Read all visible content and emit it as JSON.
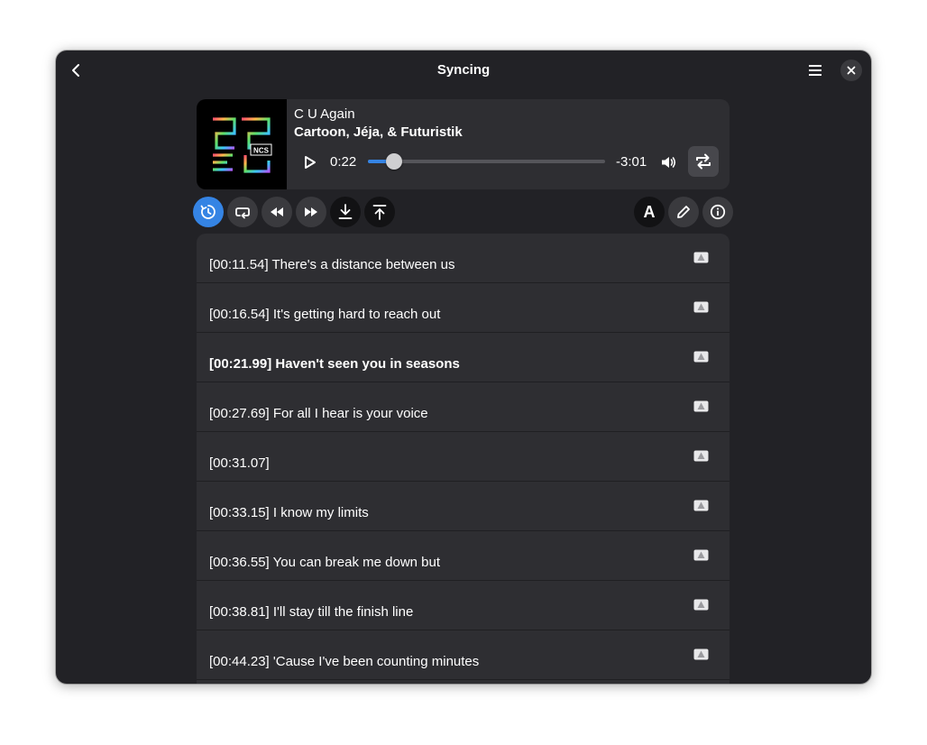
{
  "window": {
    "title": "Syncing"
  },
  "player": {
    "song_title": "C U Again",
    "artist": "Cartoon, Jéja, & Futuristik",
    "time_current": "0:22",
    "time_remaining": "-3:01",
    "progress": 0.11,
    "cover_text": "NCS",
    "accent": "#3584e4"
  },
  "toolbar": {
    "text_style_label": "A",
    "icons": [
      "sync-icon",
      "loop-line-icon",
      "rewind-icon",
      "fast-forward-icon",
      "download-icon",
      "upload-icon",
      "font-icon",
      "edit-icon",
      "info-icon"
    ]
  },
  "lyrics": {
    "current_index": 2,
    "lines": [
      "[00:11.54] There's a distance between us",
      "[00:16.54] It's getting hard to reach out",
      "[00:21.99] Haven't seen you in seasons",
      "[00:27.69] For all I hear is your voice",
      "[00:31.07]",
      "[00:33.15] I know my limits",
      "[00:36.55] You can break me down but",
      "[00:38.81] I'll stay till the finish line",
      "[00:44.23] 'Cause I've been counting minutes"
    ]
  }
}
